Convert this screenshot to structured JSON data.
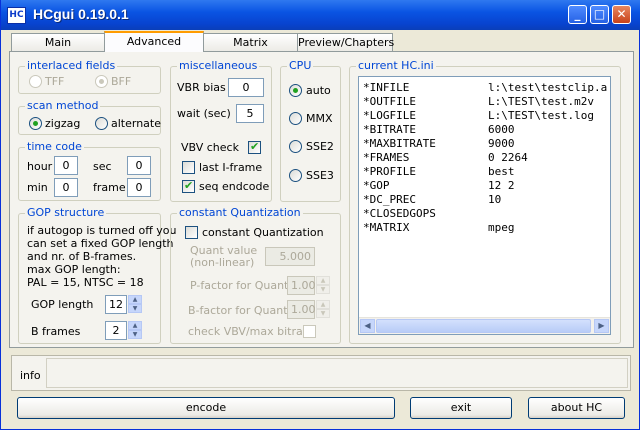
{
  "window": {
    "title": "HCgui 0.19.0.1",
    "app_icon_text": "HC",
    "controls": {
      "minimize": "_",
      "maximize": "□",
      "close": "✕"
    }
  },
  "tabs": [
    "Main",
    "Advanced",
    "Matrix",
    "Preview/Chapters"
  ],
  "active_tab": "Advanced",
  "interlaced_fields": {
    "title": "interlaced fields",
    "options": [
      "TFF",
      "BFF"
    ],
    "selected": "BFF",
    "enabled": false
  },
  "scan_method": {
    "title": "scan method",
    "options": [
      "zigzag",
      "alternate"
    ],
    "selected": "zigzag"
  },
  "time_code": {
    "title": "time code",
    "hour_label": "hour",
    "hour": "0",
    "sec_label": "sec",
    "sec": "0",
    "min_label": "min",
    "min": "0",
    "frame_label": "frame",
    "frame": "0"
  },
  "gop_structure": {
    "title": "GOP structure",
    "description_lines": [
      "if autogop is turned off you",
      "can set a fixed GOP length",
      "and nr. of B-frames.",
      "max GOP length:",
      "PAL = 15, NTSC = 18"
    ],
    "gop_length_label": "GOP length",
    "gop_length": "12",
    "b_frames_label": "B frames",
    "b_frames": "2"
  },
  "miscellaneous": {
    "title": "miscellaneous",
    "vbr_bias_label": "VBR bias",
    "vbr_bias": "0",
    "wait_label": "wait (sec)",
    "wait": "5",
    "vbv_check_label": "VBV check",
    "vbv_check": true,
    "last_iframe_label": "last I-frame",
    "last_iframe": false,
    "seq_endcode_label": "seq endcode",
    "seq_endcode": true
  },
  "cpu": {
    "title": "CPU",
    "options": [
      "auto",
      "MMX",
      "SSE2",
      "SSE3"
    ],
    "selected": "auto"
  },
  "constant_quantization": {
    "title": "constant Quantization",
    "checkbox_label": "constant Quantization",
    "checked": false,
    "quant_value_label_line1": "Quant value",
    "quant_value_label_line2": "(non-linear)",
    "quant_value": "5.000",
    "p_factor_label": "P-factor for Quant",
    "p_factor": "1.00",
    "b_factor_label": "B-factor for Quant",
    "b_factor": "1.00",
    "check_vbv_label": "check VBV/max bitrate"
  },
  "current_ini": {
    "title": "current HC.ini",
    "rows": [
      {
        "key": "*INFILE",
        "value": "l:\\test\\testclip.a"
      },
      {
        "key": "*OUTFILE",
        "value": "L:\\TEST\\test.m2v"
      },
      {
        "key": "*LOGFILE",
        "value": "L:\\TEST\\test.log"
      },
      {
        "key": "*BITRATE",
        "value": "6000"
      },
      {
        "key": "*MAXBITRATE",
        "value": "9000"
      },
      {
        "key": "*FRAMES",
        "value": "0 2264"
      },
      {
        "key": "*PROFILE",
        "value": "best"
      },
      {
        "key": "*GOP",
        "value": "12 2"
      },
      {
        "key": "*DC_PREC",
        "value": "10"
      },
      {
        "key": "*CLOSEDGOPS",
        "value": ""
      },
      {
        "key": "*MATRIX",
        "value": "mpeg"
      }
    ]
  },
  "info": {
    "label": "info",
    "text": ""
  },
  "buttons": {
    "encode": "encode",
    "exit": "exit",
    "about": "about HC"
  },
  "colors": {
    "titlebar": "#0a54e3",
    "group_title": "#0046d5",
    "active_tab_accent": "#ff9c00",
    "window_bg": "#ece9d8"
  }
}
